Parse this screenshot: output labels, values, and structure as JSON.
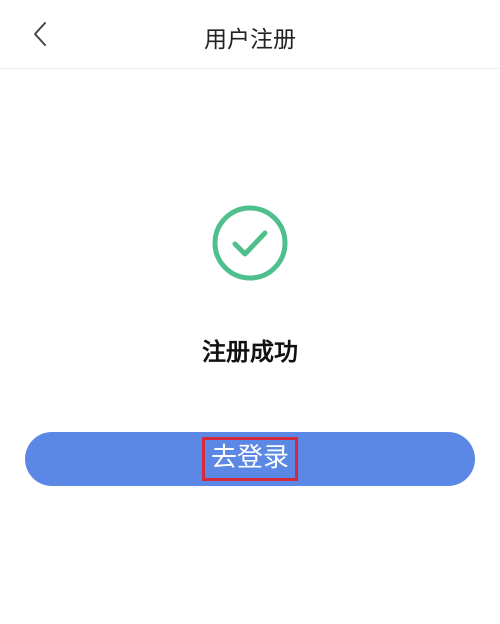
{
  "header": {
    "title": "用户注册",
    "back_icon": "chevron-left-icon"
  },
  "result": {
    "icon": "check-circle-icon",
    "icon_color": "#4fbf8c",
    "message": "注册成功"
  },
  "action": {
    "login_label": "去登录",
    "button_color": "#5b88e5",
    "highlight_color": "#d42a3c"
  }
}
